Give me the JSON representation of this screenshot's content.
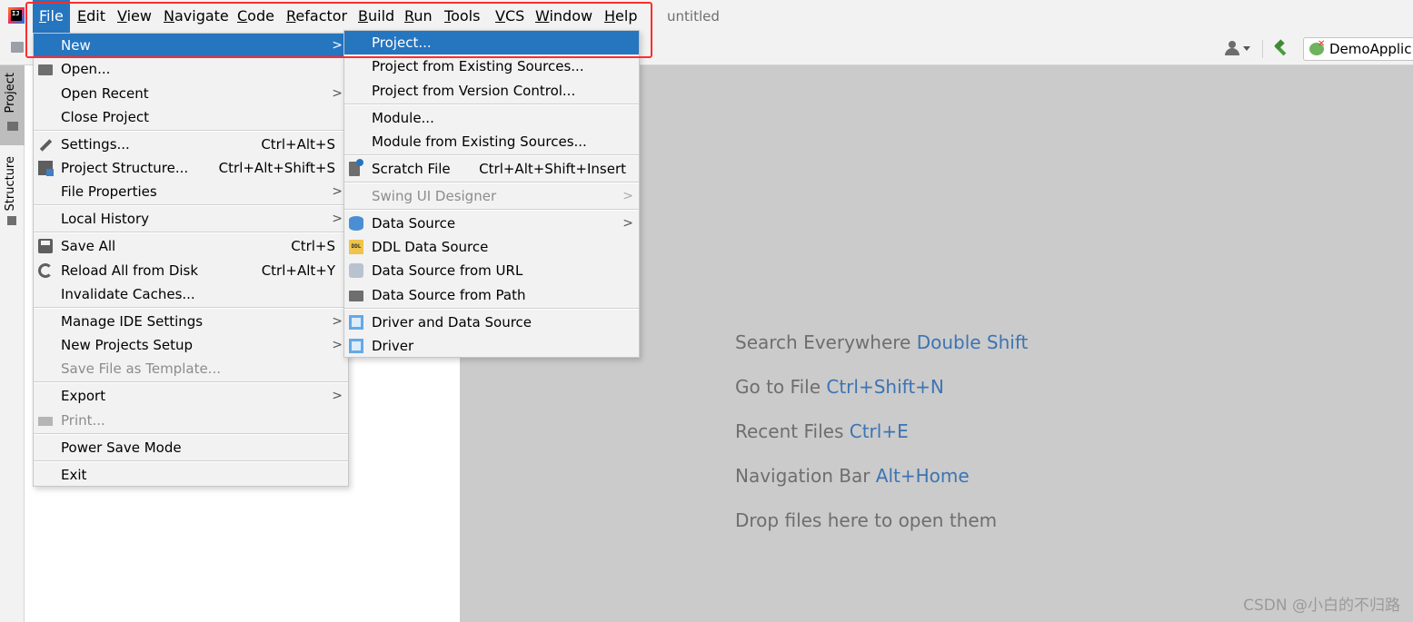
{
  "menubar": {
    "items": [
      {
        "label": "File",
        "u": "F",
        "rest": "ile"
      },
      {
        "label": "Edit",
        "u": "E",
        "rest": "dit"
      },
      {
        "label": "View",
        "u": "V",
        "rest": "iew"
      },
      {
        "label": "Navigate",
        "u": "N",
        "rest": "avigate"
      },
      {
        "label": "Code",
        "u": "C",
        "rest": "ode"
      },
      {
        "label": "Refactor",
        "u": "R",
        "rest": "efactor"
      },
      {
        "label": "Build",
        "u": "B",
        "rest": "uild"
      },
      {
        "label": "Run",
        "u": "R",
        "rest": "un"
      },
      {
        "label": "Tools",
        "u": "T",
        "rest": "ools"
      },
      {
        "label": "VCS",
        "u": "V",
        "rest": "CS"
      },
      {
        "label": "Window",
        "u": "W",
        "rest": "indow"
      },
      {
        "label": "Help",
        "u": "H",
        "rest": "elp"
      }
    ],
    "window_title": "untitled",
    "logo_text": "IJ"
  },
  "toolbar": {
    "run_config": "DemoApplic"
  },
  "left_strip": {
    "project_tab": "Project",
    "structure_tab": "Structure"
  },
  "file_menu": {
    "items": [
      {
        "label": "New",
        "shortcut": "",
        "submenu": true
      },
      {
        "label": "Open...",
        "shortcut": ""
      },
      {
        "label": "Open Recent",
        "shortcut": "",
        "submenu": true
      },
      {
        "label": "Close Project",
        "shortcut": ""
      },
      {
        "label": "Settings...",
        "shortcut": "Ctrl+Alt+S"
      },
      {
        "label": "Project Structure...",
        "shortcut": "Ctrl+Alt+Shift+S"
      },
      {
        "label": "File Properties",
        "shortcut": "",
        "submenu": true
      },
      {
        "label": "Local History",
        "shortcut": "",
        "submenu": true
      },
      {
        "label": "Save All",
        "shortcut": "Ctrl+S"
      },
      {
        "label": "Reload All from Disk",
        "shortcut": "Ctrl+Alt+Y"
      },
      {
        "label": "Invalidate Caches...",
        "shortcut": ""
      },
      {
        "label": "Manage IDE Settings",
        "shortcut": "",
        "submenu": true
      },
      {
        "label": "New Projects Setup",
        "shortcut": "",
        "submenu": true
      },
      {
        "label": "Save File as Template...",
        "shortcut": "",
        "disabled": true
      },
      {
        "label": "Export",
        "shortcut": "",
        "submenu": true
      },
      {
        "label": "Print...",
        "shortcut": "",
        "disabled": true
      },
      {
        "label": "Power Save Mode",
        "shortcut": ""
      },
      {
        "label": "Exit",
        "shortcut": ""
      }
    ]
  },
  "new_submenu": {
    "items": [
      {
        "label": "Project...",
        "shortcut": ""
      },
      {
        "label": "Project from Existing Sources...",
        "shortcut": ""
      },
      {
        "label": "Project from Version Control...",
        "shortcut": ""
      },
      {
        "label": "Module...",
        "shortcut": ""
      },
      {
        "label": "Module from Existing Sources...",
        "shortcut": ""
      },
      {
        "label": "Scratch File",
        "shortcut": "Ctrl+Alt+Shift+Insert"
      },
      {
        "label": "Swing UI Designer",
        "shortcut": "",
        "submenu": true,
        "disabled": true
      },
      {
        "label": "Data Source",
        "shortcut": "",
        "submenu": true
      },
      {
        "label": "DDL Data Source",
        "shortcut": ""
      },
      {
        "label": "Data Source from URL",
        "shortcut": ""
      },
      {
        "label": "Data Source from Path",
        "shortcut": ""
      },
      {
        "label": "Driver and Data Source",
        "shortcut": ""
      },
      {
        "label": "Driver",
        "shortcut": ""
      }
    ],
    "ddl_icon_text": "DDL"
  },
  "editor": {
    "hints": [
      {
        "text": "Search Everywhere",
        "key": "Double Shift"
      },
      {
        "text": "Go to File",
        "key": "Ctrl+Shift+N"
      },
      {
        "text": "Recent Files",
        "key": "Ctrl+E"
      },
      {
        "text": "Navigation Bar",
        "key": "Alt+Home"
      },
      {
        "text": "Drop files here to open them",
        "key": ""
      }
    ],
    "watermark": "CSDN @小白的不归路"
  },
  "colors": {
    "selection": "#2675bf",
    "highlight_box": "#ff2d2d",
    "hint_key": "#3c74b3"
  }
}
